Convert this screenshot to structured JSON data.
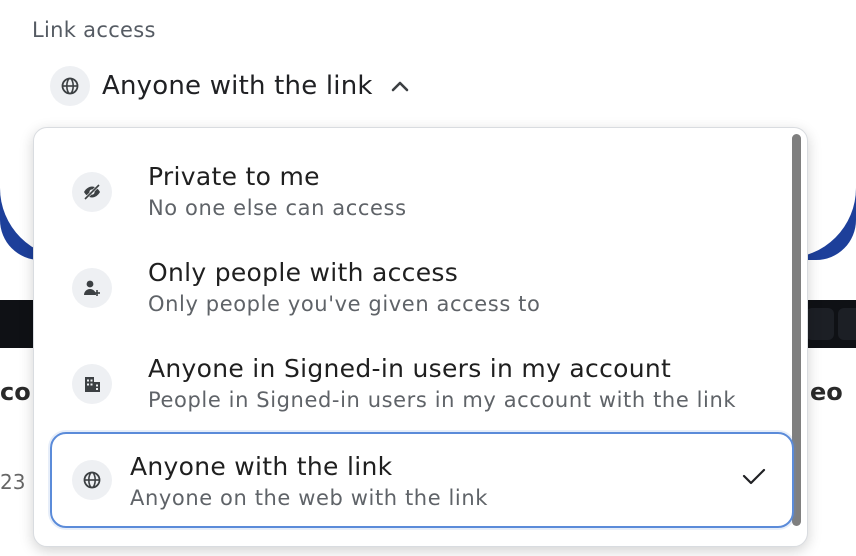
{
  "section_label": "Link access",
  "trigger": {
    "label": "Anyone with the link",
    "icon": "globe-icon",
    "chevron": "chevron-up-icon"
  },
  "options": [
    {
      "title": "Private to me",
      "subtitle": "No one else can access",
      "icon": "eye-off-icon",
      "selected": false
    },
    {
      "title": "Only people with access",
      "subtitle": "Only people you've given access to",
      "icon": "person-add-icon",
      "selected": false
    },
    {
      "title": "Anyone in Signed-in users in my account",
      "subtitle": "People in Signed-in users in my account with the link",
      "icon": "building-icon",
      "selected": false
    },
    {
      "title": "Anyone with the link",
      "subtitle": "Anyone on the web with the link",
      "icon": "globe-icon",
      "selected": true
    }
  ],
  "background_fragments": {
    "left_top": "co",
    "right_top": "eo",
    "left_bottom": "23"
  },
  "colors": {
    "selected_border": "#5b8bd9",
    "page_blue": "#1d3f9a"
  }
}
